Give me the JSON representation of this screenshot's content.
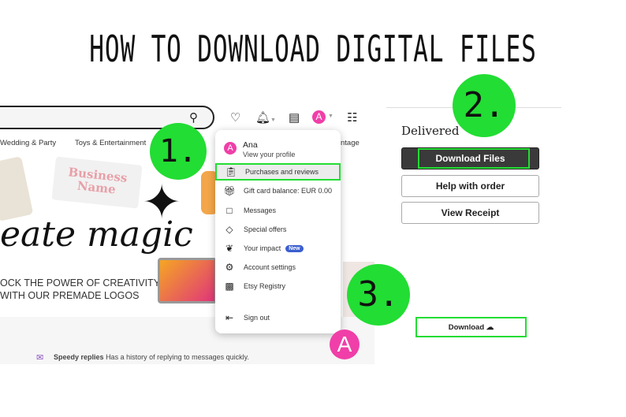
{
  "title": "HOW TO DOWNLOAD DIGITAL FILES",
  "steps": [
    "1.",
    "2.",
    "3."
  ],
  "header": {
    "nav": [
      "Wedding & Party",
      "Toys & Entertainment",
      "ntage"
    ]
  },
  "banner": {
    "headline": "eate magic",
    "tagline1": "OCK THE POWER OF CREATIVITY",
    "tagline2": "WITH OUR PREMADE LOGOS",
    "card": "Business Name"
  },
  "speedy": {
    "label": "Speedy replies",
    "text": "Has a history of replying to messages quickly."
  },
  "menu": {
    "avatar": "A",
    "name": "Ana",
    "profile": "View your profile",
    "items": [
      {
        "icon": "clipboard-icon",
        "label": "Purchases and reviews"
      },
      {
        "icon": "gift-icon",
        "label": "Gift card balance: EUR 0.00"
      },
      {
        "icon": "messages-icon",
        "label": "Messages"
      },
      {
        "icon": "tag-icon",
        "label": "Special offers"
      },
      {
        "icon": "leaf-icon",
        "label": "Your impact",
        "badge": "New"
      },
      {
        "icon": "gear-icon",
        "label": "Account settings"
      },
      {
        "icon": "registry-icon",
        "label": "Etsy Registry"
      },
      {
        "icon": "sign-out-icon",
        "label": "Sign out"
      }
    ]
  },
  "order": {
    "status": "Delivered",
    "download_files": "Download Files",
    "help": "Help with order",
    "receipt": "View Receipt",
    "download": "Download"
  },
  "colors": {
    "highlight": "#22dd33",
    "avatar": "#f03fa8",
    "dark_button": "#3a3a3a"
  }
}
